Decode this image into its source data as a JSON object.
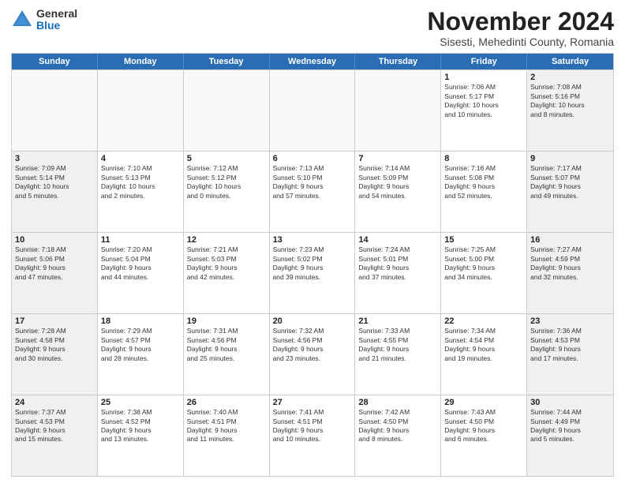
{
  "logo": {
    "general": "General",
    "blue": "Blue"
  },
  "title": "November 2024",
  "location": "Sisesti, Mehedinti County, Romania",
  "header_days": [
    "Sunday",
    "Monday",
    "Tuesday",
    "Wednesday",
    "Thursday",
    "Friday",
    "Saturday"
  ],
  "rows": [
    [
      {
        "day": "",
        "info": ""
      },
      {
        "day": "",
        "info": ""
      },
      {
        "day": "",
        "info": ""
      },
      {
        "day": "",
        "info": ""
      },
      {
        "day": "",
        "info": ""
      },
      {
        "day": "1",
        "info": "Sunrise: 7:06 AM\nSunset: 5:17 PM\nDaylight: 10 hours\nand 10 minutes."
      },
      {
        "day": "2",
        "info": "Sunrise: 7:08 AM\nSunset: 5:16 PM\nDaylight: 10 hours\nand 8 minutes."
      }
    ],
    [
      {
        "day": "3",
        "info": "Sunrise: 7:09 AM\nSunset: 5:14 PM\nDaylight: 10 hours\nand 5 minutes."
      },
      {
        "day": "4",
        "info": "Sunrise: 7:10 AM\nSunset: 5:13 PM\nDaylight: 10 hours\nand 2 minutes."
      },
      {
        "day": "5",
        "info": "Sunrise: 7:12 AM\nSunset: 5:12 PM\nDaylight: 10 hours\nand 0 minutes."
      },
      {
        "day": "6",
        "info": "Sunrise: 7:13 AM\nSunset: 5:10 PM\nDaylight: 9 hours\nand 57 minutes."
      },
      {
        "day": "7",
        "info": "Sunrise: 7:14 AM\nSunset: 5:09 PM\nDaylight: 9 hours\nand 54 minutes."
      },
      {
        "day": "8",
        "info": "Sunrise: 7:16 AM\nSunset: 5:08 PM\nDaylight: 9 hours\nand 52 minutes."
      },
      {
        "day": "9",
        "info": "Sunrise: 7:17 AM\nSunset: 5:07 PM\nDaylight: 9 hours\nand 49 minutes."
      }
    ],
    [
      {
        "day": "10",
        "info": "Sunrise: 7:18 AM\nSunset: 5:06 PM\nDaylight: 9 hours\nand 47 minutes."
      },
      {
        "day": "11",
        "info": "Sunrise: 7:20 AM\nSunset: 5:04 PM\nDaylight: 9 hours\nand 44 minutes."
      },
      {
        "day": "12",
        "info": "Sunrise: 7:21 AM\nSunset: 5:03 PM\nDaylight: 9 hours\nand 42 minutes."
      },
      {
        "day": "13",
        "info": "Sunrise: 7:23 AM\nSunset: 5:02 PM\nDaylight: 9 hours\nand 39 minutes."
      },
      {
        "day": "14",
        "info": "Sunrise: 7:24 AM\nSunset: 5:01 PM\nDaylight: 9 hours\nand 37 minutes."
      },
      {
        "day": "15",
        "info": "Sunrise: 7:25 AM\nSunset: 5:00 PM\nDaylight: 9 hours\nand 34 minutes."
      },
      {
        "day": "16",
        "info": "Sunrise: 7:27 AM\nSunset: 4:59 PM\nDaylight: 9 hours\nand 32 minutes."
      }
    ],
    [
      {
        "day": "17",
        "info": "Sunrise: 7:28 AM\nSunset: 4:58 PM\nDaylight: 9 hours\nand 30 minutes."
      },
      {
        "day": "18",
        "info": "Sunrise: 7:29 AM\nSunset: 4:57 PM\nDaylight: 9 hours\nand 28 minutes."
      },
      {
        "day": "19",
        "info": "Sunrise: 7:31 AM\nSunset: 4:56 PM\nDaylight: 9 hours\nand 25 minutes."
      },
      {
        "day": "20",
        "info": "Sunrise: 7:32 AM\nSunset: 4:56 PM\nDaylight: 9 hours\nand 23 minutes."
      },
      {
        "day": "21",
        "info": "Sunrise: 7:33 AM\nSunset: 4:55 PM\nDaylight: 9 hours\nand 21 minutes."
      },
      {
        "day": "22",
        "info": "Sunrise: 7:34 AM\nSunset: 4:54 PM\nDaylight: 9 hours\nand 19 minutes."
      },
      {
        "day": "23",
        "info": "Sunrise: 7:36 AM\nSunset: 4:53 PM\nDaylight: 9 hours\nand 17 minutes."
      }
    ],
    [
      {
        "day": "24",
        "info": "Sunrise: 7:37 AM\nSunset: 4:53 PM\nDaylight: 9 hours\nand 15 minutes."
      },
      {
        "day": "25",
        "info": "Sunrise: 7:38 AM\nSunset: 4:52 PM\nDaylight: 9 hours\nand 13 minutes."
      },
      {
        "day": "26",
        "info": "Sunrise: 7:40 AM\nSunset: 4:51 PM\nDaylight: 9 hours\nand 11 minutes."
      },
      {
        "day": "27",
        "info": "Sunrise: 7:41 AM\nSunset: 4:51 PM\nDaylight: 9 hours\nand 10 minutes."
      },
      {
        "day": "28",
        "info": "Sunrise: 7:42 AM\nSunset: 4:50 PM\nDaylight: 9 hours\nand 8 minutes."
      },
      {
        "day": "29",
        "info": "Sunrise: 7:43 AM\nSunset: 4:50 PM\nDaylight: 9 hours\nand 6 minutes."
      },
      {
        "day": "30",
        "info": "Sunrise: 7:44 AM\nSunset: 4:49 PM\nDaylight: 9 hours\nand 5 minutes."
      }
    ]
  ]
}
